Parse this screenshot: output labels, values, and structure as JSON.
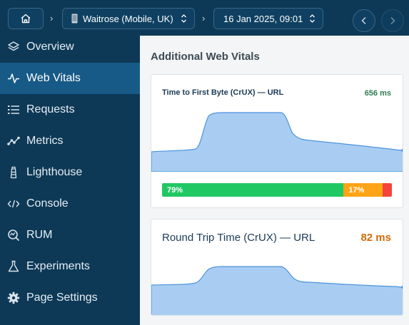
{
  "header": {
    "home_label": "Home",
    "site_label": "Waitrose (Mobile, UK)",
    "date_label": "16 Jan 2025, 09:01"
  },
  "sidebar": {
    "items": [
      {
        "label": "Overview",
        "icon": "layers-icon"
      },
      {
        "label": "Web Vitals",
        "icon": "pulse-icon",
        "active": true
      },
      {
        "label": "Requests",
        "icon": "list-icon"
      },
      {
        "label": "Metrics",
        "icon": "chart-icon"
      },
      {
        "label": "Lighthouse",
        "icon": "lighthouse-icon"
      },
      {
        "label": "Console",
        "icon": "code-icon"
      },
      {
        "label": "RUM",
        "icon": "rum-icon"
      },
      {
        "label": "Experiments",
        "icon": "flask-icon"
      },
      {
        "label": "Page Settings",
        "icon": "gear-icon"
      }
    ]
  },
  "main": {
    "section_title": "Additional Web Vitals",
    "cards": [
      {
        "title": "Time to First Byte (CrUX) — URL",
        "value": "656 ms",
        "value_color": "#2e7d4f",
        "distribution": [
          {
            "label": "79%",
            "fraction": 0.79,
            "color": "#20c863"
          },
          {
            "label": "17%",
            "fraction": 0.17,
            "color": "#ffa415"
          },
          {
            "label": "",
            "fraction": 0.04,
            "color": "#f4433a"
          }
        ]
      },
      {
        "title": "Round Trip Time (CrUX) — URL",
        "value": "82 ms",
        "value_color": "#d36b0a"
      }
    ]
  },
  "colors": {
    "sidebar_bg": "#0d3956",
    "active_bg": "#175a87",
    "area_fill": "#a9cdf2",
    "area_line": "#4b93dd"
  }
}
